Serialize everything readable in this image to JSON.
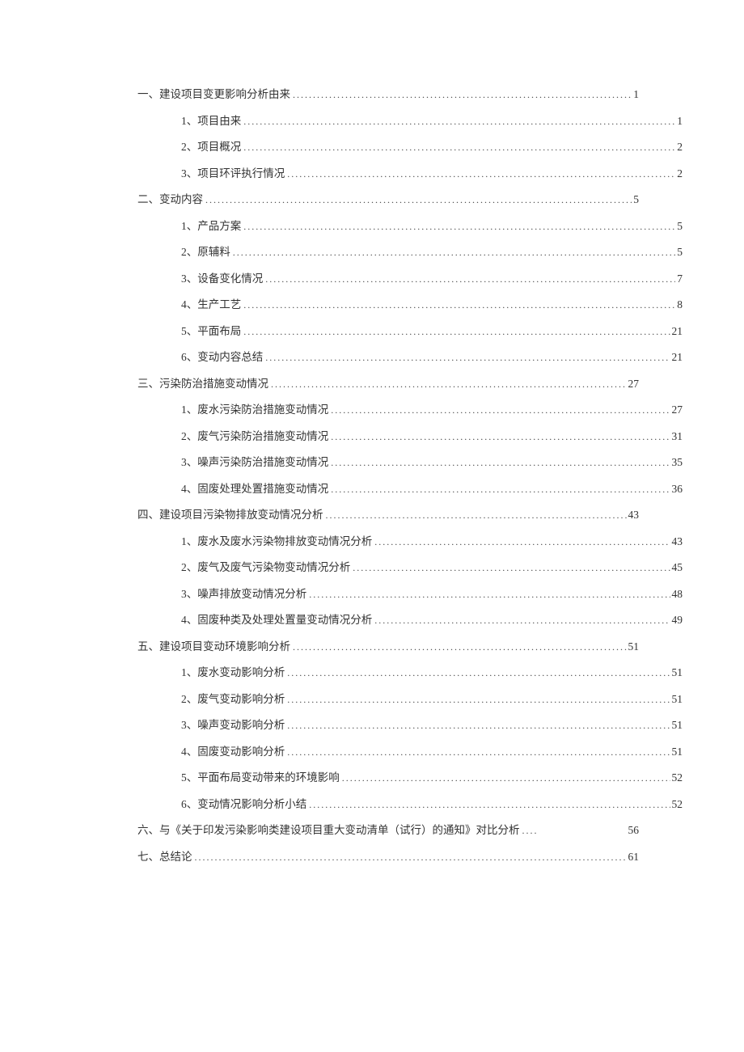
{
  "toc": [
    {
      "level": 1,
      "prefix": "一、",
      "title": "建设项目变更影响分析由来",
      "page": "1",
      "leader": true
    },
    {
      "level": 2,
      "prefix": "1、",
      "title": "项目由来",
      "page": "1",
      "leader": true
    },
    {
      "level": 2,
      "prefix": "2、",
      "title": "项目概况",
      "page": "2",
      "leader": true
    },
    {
      "level": 2,
      "prefix": "3、",
      "title": "项目环评执行情况",
      "page": "2",
      "leader": true
    },
    {
      "level": 1,
      "prefix": "二、",
      "title": "变动内容",
      "page": "5",
      "leader": true
    },
    {
      "level": 2,
      "prefix": "1、",
      "title": "产品方案",
      "page": "5",
      "leader": true
    },
    {
      "level": 2,
      "prefix": "2、",
      "title": "原辅料",
      "page": "5",
      "leader": true
    },
    {
      "level": 2,
      "prefix": "3、",
      "title": "设备变化情况",
      "page": "7",
      "leader": true
    },
    {
      "level": 2,
      "prefix": "4、",
      "title": "生产工艺",
      "page": "8",
      "leader": true
    },
    {
      "level": 2,
      "prefix": "5、",
      "title": "平面布局",
      "page": "21",
      "leader": true
    },
    {
      "level": 2,
      "prefix": "6、",
      "title": "变动内容总结",
      "page": "21",
      "leader": true
    },
    {
      "level": 1,
      "prefix": "三、",
      "title": "污染防治措施变动情况",
      "page": "27",
      "leader": true
    },
    {
      "level": 2,
      "prefix": "1、",
      "title": "废水污染防治措施变动情况",
      "page": "27",
      "leader": true
    },
    {
      "level": 2,
      "prefix": "2、",
      "title": "废气污染防治措施变动情况",
      "page": "31",
      "leader": true
    },
    {
      "level": 2,
      "prefix": "3、",
      "title": "噪声污染防治措施变动情况",
      "page": "35",
      "leader": true
    },
    {
      "level": 2,
      "prefix": "4、",
      "title": "固废处理处置措施变动情况",
      "page": "36",
      "leader": true
    },
    {
      "level": 1,
      "prefix": "四、",
      "title": "建设项目污染物排放变动情况分析",
      "page": "43",
      "leader": true
    },
    {
      "level": 2,
      "prefix": "1、",
      "title": "废水及废水污染物排放变动情况分析",
      "page": "43",
      "leader": true
    },
    {
      "level": 2,
      "prefix": "2、",
      "title": "废气及废气污染物变动情况分析",
      "page": "45",
      "leader": true
    },
    {
      "level": 2,
      "prefix": "3、",
      "title": "噪声排放变动情况分析",
      "page": "48",
      "leader": true
    },
    {
      "level": 2,
      "prefix": "4、",
      "title": "固废种类及处理处置量变动情况分析",
      "page": "49",
      "leader": true
    },
    {
      "level": 1,
      "prefix": "五、",
      "title": "建设项目变动环境影响分析",
      "page": "51",
      "leader": true
    },
    {
      "level": 2,
      "prefix": "1、",
      "title": "废水变动影响分析",
      "page": "51",
      "leader": true
    },
    {
      "level": 2,
      "prefix": "2、",
      "title": "废气变动影响分析",
      "page": "51",
      "leader": true
    },
    {
      "level": 2,
      "prefix": "3、",
      "title": "噪声变动影响分析",
      "page": "51",
      "leader": true
    },
    {
      "level": 2,
      "prefix": "4、",
      "title": "固废变动影响分析",
      "page": "51",
      "leader": true
    },
    {
      "level": 2,
      "prefix": "5、",
      "title": "平面布局变动带来的环境影响",
      "page": "52",
      "leader": true
    },
    {
      "level": 2,
      "prefix": "6、",
      "title": "变动情况影响分析小结",
      "page": "52",
      "leader": true
    },
    {
      "level": 1,
      "prefix": "六、",
      "title": "与《关于印发污染影响类建设项目重大变动清单（试行）的通知》对比分析",
      "page": "56",
      "leader": false
    },
    {
      "level": 1,
      "prefix": "七、",
      "title": "总结论",
      "page": "61",
      "leader": true
    }
  ]
}
